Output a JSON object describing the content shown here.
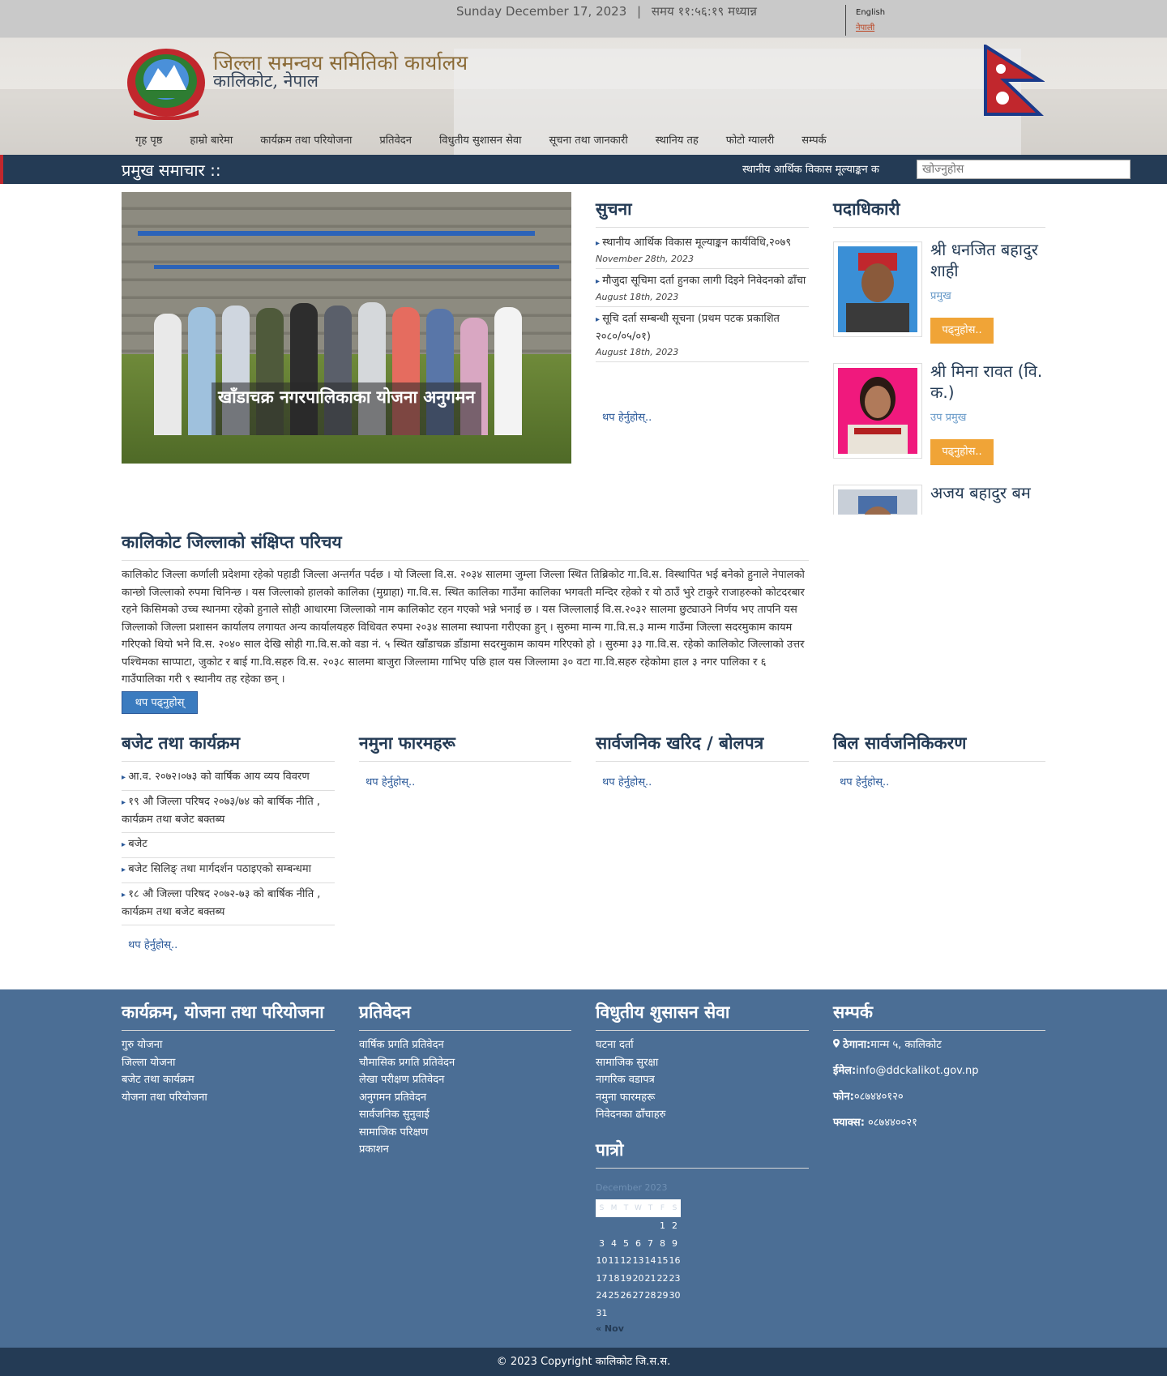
{
  "topbar": {
    "date": "Sunday December 17, 2023",
    "separator": "|",
    "time": "समय ११:५६:१९ मध्यान्न",
    "lang_english": "English",
    "lang_nepali": "नेपाली"
  },
  "header": {
    "title": "जिल्ला समन्वय समितिको कार्यालय",
    "subtitle": "कालिकोट, नेपाल"
  },
  "nav": {
    "items": [
      "गृह पृष्ठ",
      "हाम्रो बारेमा",
      "कार्यक्रम तथा परियोजना",
      "प्रतिवेदन",
      "विधुतीय सुशासन सेवा",
      "सूचना तथा जानकारी",
      "स्थानिय तह",
      "फोटो ग्यालरी",
      "सम्पर्क"
    ]
  },
  "newsbar": {
    "label": "प्रमुख समाचार ::",
    "ticker": "स्थानीय आर्थिक विकास मूल्याङ्कन क",
    "search_placeholder": "खोज्नुहोस"
  },
  "slider": {
    "caption": "खाँडाचक्र नगरपालिकाका योजना अनुगमन"
  },
  "notice": {
    "heading": "सुचना",
    "items": [
      {
        "title": "स्थानीय आर्थिक विकास मूल्याङ्कन कार्यविधि,२०७९",
        "date": "November 28th, 2023"
      },
      {
        "title": "मौजुदा सूचिमा दर्ता हुनका लागी दिइने निवेदनको ढाँचा",
        "date": "August 18th, 2023"
      },
      {
        "title": "सूचि दर्ता सम्बन्धी सूचना (प्रथम पटक प्रकाशित २०८०/०५/०१)",
        "date": "August 18th, 2023"
      }
    ],
    "more": "थप हेर्नुहोस्.."
  },
  "officials": {
    "heading": "पदाधिकारी",
    "items": [
      {
        "name": "श्री धनजित बहादुर शाही",
        "role": "प्रमुख",
        "button": "पढ्नुहोस.."
      },
      {
        "name": "श्री मिना रावत (वि. क.)",
        "role": "उप प्रमुख",
        "button": "पढ्नुहोस.."
      },
      {
        "name": "अजय बहादुर बम",
        "role": "",
        "button": ""
      }
    ]
  },
  "intro": {
    "heading": "कालिकोट जिल्लाको संक्षिप्त परिचय",
    "body": "कालिकोट जिल्ला कर्णाली प्रदेशमा रहेको पहाडी जिल्ला अन्तर्गत पर्दछ । यो जिल्ला वि.स. २०३४ सालमा जुम्ला जिल्ला स्थित तिब्रिकोट गा.वि.स. विस्थापित भई बनेको हुनाले नेपालको कान्छो जिल्लाको रुपमा चिनिन्छ । यस जिल्लाको हालको कालिका (मुग्राहा) गा.वि.स. स्थित कालिका गाउँमा कालिका भगवती मन्दिर रहेको र यो ठाउँ भुरे टाकुरे राजाहरुको कोटदरबार रहने किसिमको उच्च स्थानमा रहेको हुनाले सोही आधारमा जिल्लाको नाम कालिकोट रहन गएको भन्ने भनाई छ । यस जिल्लालाई वि.स.२०३२ सालमा छुट्याउने निर्णय भए तापनि यस जिल्लाको जिल्ला प्रशासन कार्यालय लगायत अन्य कार्यालयहरु विधिवत रुपमा २०३४ सालमा स्थापना गरीएका हुन् । सुरुमा मान्म गा.वि.स.३ मान्म गाउँमा जिल्ला सदरमुकाम कायम गरिएको थियो भने वि.स. २०४० साल देखि सोही गा.वि.स.को वडा नं. ५ स्थित खाँडाचक्र डाँडामा सदरमुकाम कायम गरिएको हो । सुरुमा ३३ गा.वि.स. रहेको कालिकोट जिल्लाको उत्तर पश्चिमका साप्पाटा, जुकोट र बाई गा.वि.सहरु वि.स. २०३८ सालमा बाजुरा जिल्लामा गाभिए पछि हाल यस जिल्लामा ३० वटा गा.वि.सहरु रहेकोमा हाल ३ नगर पालिका र ६ गाउँपालिका गरी ९ स्थानीय तह रहेका छन् ।",
    "button": "थप पढ्नुहोस्"
  },
  "budget": {
    "heading": "बजेट तथा कार्यक्रम",
    "items": [
      "आ.व. २०७२।०७३ को वार्षिक आय व्यय विवरण",
      "१९ औ जिल्ला परिषद २०७३/७४ को बार्षिक नीति , कार्यक्रम तथा बजेट बक्तब्य",
      "बजेट",
      "बजेट सिलिङ् तथा मार्गदर्शन पठाइएको सम्बन्धमा",
      "१८ औ जिल्ला परिषद २०७२-७३ को बार्षिक नीति , कार्यक्रम तथा बजेट बक्तब्य"
    ],
    "more": "थप हेर्नुहोस्.."
  },
  "forms": {
    "heading": "नमुना फारमहरू",
    "more": "थप हेर्नुहोस्.."
  },
  "procurement": {
    "heading": "सार्वजनिक खरिद / बोलपत्र",
    "more": "थप हेर्नुहोस्.."
  },
  "bills": {
    "heading": "बिल सार्वजनिकिकरण",
    "more": "थप हेर्नुहोस्.."
  },
  "footer": {
    "col1": {
      "heading": "कार्यक्रम, योजना तथा परियोजना",
      "items": [
        "गुरु योजना",
        "जिल्ला योजना",
        "बजेट तथा कार्यक्रम",
        "योजना तथा परियोजना"
      ]
    },
    "col2": {
      "heading": "प्रतिवेदन",
      "items": [
        "वार्षिक प्रगति प्रतिवेदन",
        "चौमासिक प्रगति प्रतिवेदन",
        "लेखा परीक्षण प्रतिवेदन",
        "अनुगमन प्रतिवेदन",
        "सार्वजनिक सुनुवाई",
        "सामाजिक परिक्षण",
        "प्रकाशन"
      ]
    },
    "col3": {
      "heading": "विधुतीय शुसासन सेवा",
      "items": [
        "घटना दर्ता",
        "सामाजिक सुरक्षा",
        "नागरिक वडापत्र",
        "नमुना फारमहरू",
        "निवेदनका ढाँचाहरु"
      ]
    },
    "contact": {
      "heading": "सम्पर्क",
      "address_label": "ठेगाना:",
      "address": "मान्म ५, कालिकोट",
      "email_label": "ईमेल:",
      "email": "info@ddckalikot.gov.np",
      "phone_label": "फोन:",
      "phone": "०८७४४०१२०",
      "fax_label": "फ्याक्स:",
      "fax": " ०८७४४००२१"
    },
    "calendar": {
      "heading": "पात्रो",
      "month": "December 2023",
      "weekdays": [
        "S",
        "M",
        "T",
        "W",
        "T",
        "F",
        "S"
      ],
      "prev": "« Nov"
    },
    "copyright": "© 2023 Copyright कालिकोट जि.स.स."
  },
  "colors": {
    "navy": "#243b55",
    "footer_blue": "#4b6e95",
    "accent_orange": "#f0a437",
    "link_blue": "#2c5a9a",
    "flag_red": "#c1272d"
  }
}
